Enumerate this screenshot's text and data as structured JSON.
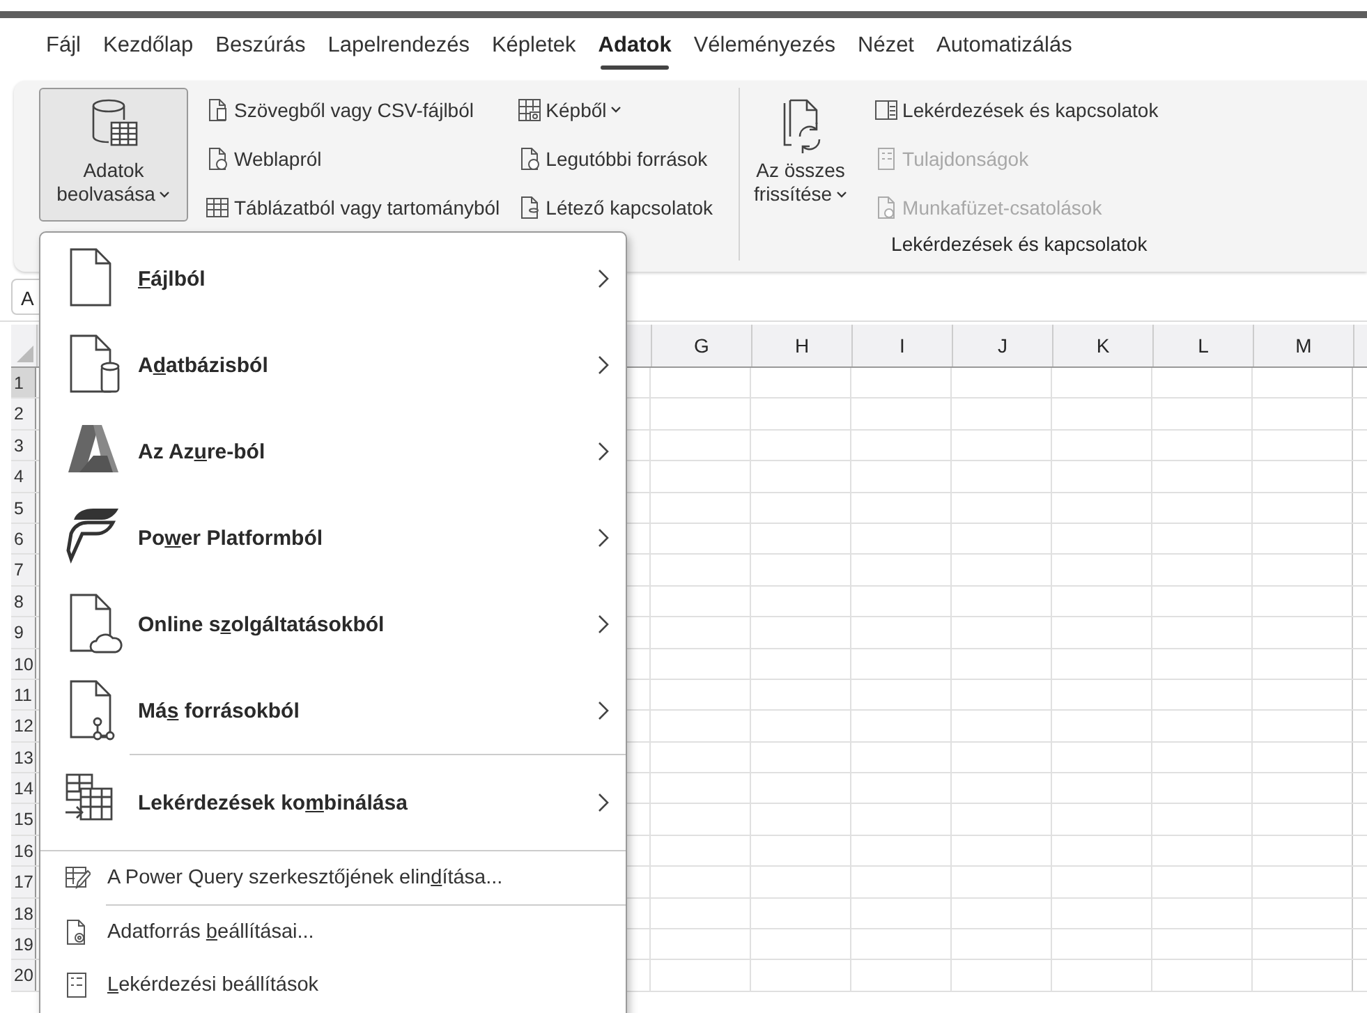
{
  "tabs": [
    {
      "label": "Fájl",
      "selected": false
    },
    {
      "label": "Kezdőlap",
      "selected": false
    },
    {
      "label": "Beszúrás",
      "selected": false
    },
    {
      "label": "Lapelrendezés",
      "selected": false
    },
    {
      "label": "Képletek",
      "selected": false
    },
    {
      "label": "Adatok",
      "selected": true
    },
    {
      "label": "Véleményezés",
      "selected": false
    },
    {
      "label": "Nézet",
      "selected": false
    },
    {
      "label": "Automatizálás",
      "selected": false
    }
  ],
  "ribbon": {
    "get_data_button": {
      "lines": [
        "Adatok",
        "beolvasása"
      ],
      "dropdown": true,
      "pressed": true
    },
    "source_columns": [
      [
        {
          "label": "Szövegből vagy CSV-fájlból",
          "dropdown": false
        },
        {
          "label": "Weblapról",
          "dropdown": false
        },
        {
          "label": "Táblázatból vagy tartományból",
          "dropdown": false
        }
      ],
      [
        {
          "label": "Képből",
          "dropdown": true
        },
        {
          "label": "Legutóbbi források",
          "dropdown": false
        },
        {
          "label": "Létező kapcsolatok",
          "dropdown": false
        }
      ]
    ],
    "queries_group": {
      "label": "Lekérdezések és kapcsolatok",
      "refresh_button": {
        "lines": [
          "Az összes",
          "frissítése"
        ],
        "dropdown": true
      },
      "buttons": [
        {
          "label": "Lekérdezések és kapcsolatok",
          "disabled": false
        },
        {
          "label": "Tulajdonságok",
          "disabled": true
        },
        {
          "label": "Munkafüzet-csatolások",
          "disabled": true
        }
      ]
    }
  },
  "name_box": {
    "value": "A"
  },
  "sheet": {
    "columns": [
      "G",
      "H",
      "I",
      "J",
      "K",
      "L",
      "M"
    ],
    "rows": [
      {
        "label": "1",
        "selected": true
      },
      {
        "label": "2",
        "selected": false
      },
      {
        "label": "3",
        "selected": false
      },
      {
        "label": "4",
        "selected": false
      },
      {
        "label": "5",
        "selected": false
      },
      {
        "label": "6",
        "selected": false
      },
      {
        "label": "7",
        "selected": false
      },
      {
        "label": "8",
        "selected": false
      },
      {
        "label": "9",
        "selected": false
      },
      {
        "label": "10",
        "selected": false
      },
      {
        "label": "11",
        "selected": false
      },
      {
        "label": "12",
        "selected": false
      },
      {
        "label": "13",
        "selected": false
      },
      {
        "label": "14",
        "selected": false
      },
      {
        "label": "15",
        "selected": false
      },
      {
        "label": "16",
        "selected": false
      },
      {
        "label": "17",
        "selected": false
      },
      {
        "label": "18",
        "selected": false
      },
      {
        "label": "19",
        "selected": false
      },
      {
        "label": "20",
        "selected": false
      }
    ]
  },
  "menu": {
    "items": [
      {
        "kind": "submenu",
        "key": "F",
        "after": "ájlból"
      },
      {
        "kind": "submenu",
        "before": "A",
        "key": "d",
        "after": "atbázisból"
      },
      {
        "kind": "submenu",
        "before": "Az Az",
        "key": "u",
        "after": "re-ból"
      },
      {
        "kind": "submenu",
        "before": "Po",
        "key": "w",
        "after": "er Platformból"
      },
      {
        "kind": "submenu",
        "before": "Online s",
        "key": "z",
        "after": "olgáltatásokból"
      },
      {
        "kind": "submenu",
        "before": "Má",
        "key": "s",
        "after": " forrásokból"
      },
      {
        "kind": "separator"
      },
      {
        "kind": "submenu",
        "before": "Lekérdezések ko",
        "key": "m",
        "after": "binálása"
      },
      {
        "kind": "separator"
      },
      {
        "kind": "command",
        "before": "A Power Query szerkesztőjének elin",
        "key": "d",
        "after": "ítása..."
      },
      {
        "kind": "separator"
      },
      {
        "kind": "command",
        "before": "Adatforrás ",
        "key": "b",
        "after": "eállításai..."
      },
      {
        "kind": "command",
        "key": "L",
        "after": "ekérdezési beállítások"
      }
    ]
  }
}
